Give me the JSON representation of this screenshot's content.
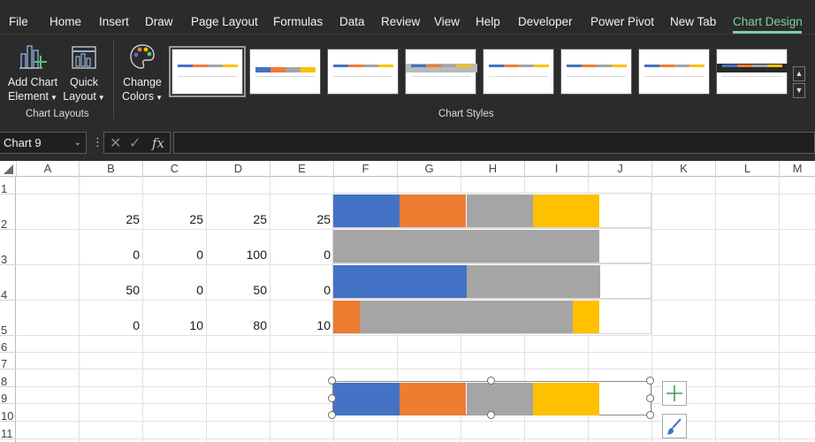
{
  "menu": {
    "items": [
      "File",
      "Home",
      "Insert",
      "Draw",
      "Page Layout",
      "Formulas",
      "Data",
      "Review",
      "View",
      "Help",
      "Developer",
      "Power Pivot",
      "New Tab",
      "Chart Design"
    ],
    "active": "Chart Design",
    "active_color": "#7bd2a1"
  },
  "ribbon": {
    "add_chart_element": {
      "line1": "Add Chart",
      "line2": "Element"
    },
    "quick_layout": {
      "line1": "Quick",
      "line2": "Layout"
    },
    "change_colors": {
      "line1": "Change",
      "line2": "Colors"
    },
    "group_chart_layouts": "Chart Layouts",
    "group_chart_styles": "Chart Styles",
    "style_count": 8
  },
  "formula_bar": {
    "name_box": "Chart 9",
    "formula": ""
  },
  "grid": {
    "columns": [
      "A",
      "B",
      "C",
      "D",
      "E",
      "F",
      "G",
      "H",
      "I",
      "J",
      "K",
      "L",
      "M"
    ],
    "rows": [
      "1",
      "2",
      "3",
      "4",
      "5",
      "6",
      "7",
      "8",
      "9",
      "10",
      "11"
    ],
    "values": {
      "B2": "25",
      "C2": "25",
      "D2": "25",
      "E2": "25",
      "B3": "0",
      "C3": "0",
      "D3": "100",
      "E3": "0",
      "B4": "50",
      "C4": "0",
      "D4": "50",
      "E4": "0",
      "B5": "0",
      "C5": "10",
      "D5": "80",
      "E5": "10"
    }
  },
  "colors": {
    "series1": "#4472c4",
    "series2": "#ed7d31",
    "series3": "#a5a5a5",
    "series4": "#ffc000",
    "ribbon_bg": "#2b2b2b"
  },
  "chart_data": [
    {
      "type": "bar",
      "stacked": true,
      "series": [
        {
          "values": [
            25
          ]
        },
        {
          "values": [
            25
          ]
        },
        {
          "values": [
            25
          ]
        },
        {
          "values": [
            25
          ]
        }
      ],
      "xlim": [
        0,
        120
      ]
    },
    {
      "type": "bar",
      "stacked": true,
      "series": [
        {
          "values": [
            0
          ]
        },
        {
          "values": [
            0
          ]
        },
        {
          "values": [
            100
          ]
        },
        {
          "values": [
            0
          ]
        }
      ],
      "xlim": [
        0,
        120
      ]
    },
    {
      "type": "bar",
      "stacked": true,
      "series": [
        {
          "values": [
            50
          ]
        },
        {
          "values": [
            0
          ]
        },
        {
          "values": [
            50
          ]
        },
        {
          "values": [
            0
          ]
        }
      ],
      "xlim": [
        0,
        120
      ]
    },
    {
      "type": "bar",
      "stacked": true,
      "series": [
        {
          "values": [
            0
          ]
        },
        {
          "values": [
            10
          ]
        },
        {
          "values": [
            80
          ]
        },
        {
          "values": [
            10
          ]
        }
      ],
      "xlim": [
        0,
        120
      ]
    },
    {
      "type": "bar",
      "stacked": true,
      "series": [
        {
          "values": [
            25
          ]
        },
        {
          "values": [
            25
          ]
        },
        {
          "values": [
            25
          ]
        },
        {
          "values": [
            25
          ]
        }
      ],
      "xlim": [
        0,
        120
      ],
      "selected": true
    }
  ],
  "icons": {
    "add_chart_element": "add-chart-element-icon",
    "quick_layout": "quick-layout-icon",
    "change_colors": "palette-icon",
    "cancel": "close-icon",
    "enter": "check-icon",
    "function": "fx-icon",
    "chart_elements": "plus-icon",
    "chart_styles": "brush-icon"
  }
}
